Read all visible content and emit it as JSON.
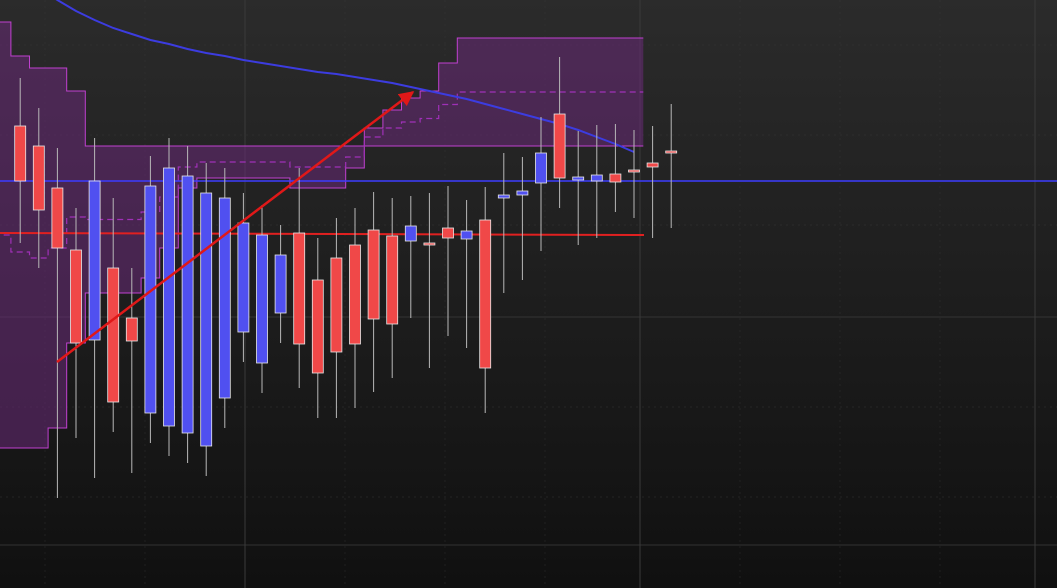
{
  "chart_data": {
    "type": "candlestick",
    "title": "",
    "xlabel": "",
    "ylabel": "",
    "ylim": [
      0,
      588
    ],
    "grid": true,
    "legend": "none",
    "colors": {
      "background_top": "#2b2b2b",
      "background_bottom": "#101010",
      "grid": "#3a3a3a",
      "bullish": "#5050f0",
      "bearish": "#f04848",
      "band_fill": "#6a2a78",
      "band_edge": "#c040d0",
      "midline": "#a030b8",
      "long_ma": "#3c3ce0",
      "horizontal_blue": "#3c3cff",
      "horizontal_red": "#e02020",
      "trend_arrow": "#e01818"
    },
    "candles": [
      {
        "o": 462,
        "h": 480,
        "l": 375,
        "c": 407
      },
      {
        "o": 442,
        "h": 450,
        "l": 350,
        "c": 378
      },
      {
        "o": 400,
        "h": 410,
        "l": 120,
        "c": 340
      },
      {
        "o": 338,
        "h": 350,
        "l": 180,
        "c": 245
      },
      {
        "o": 248,
        "h": 420,
        "l": 140,
        "c": 407
      },
      {
        "o": 320,
        "h": 360,
        "l": 250,
        "c": 186
      },
      {
        "o": 270,
        "h": 290,
        "l": 145,
        "c": 247
      },
      {
        "o": 175,
        "h": 181,
        "l": 360,
        "c": 402
      },
      {
        "o": 162,
        "h": 150,
        "l": 450,
        "c": 420
      },
      {
        "o": 155,
        "h": 170,
        "l": 455,
        "c": 412
      },
      {
        "o": 142,
        "h": 160,
        "l": 430,
        "c": 395
      },
      {
        "o": 190,
        "h": 210,
        "l": 412,
        "c": 390
      },
      {
        "o": 256,
        "h": 276,
        "l": 385,
        "c": 365
      },
      {
        "o": 225,
        "h": 244,
        "l": 363,
        "c": 353
      },
      {
        "o": 275,
        "h": 290,
        "l": 340,
        "c": 333
      },
      {
        "o": 355,
        "h": 390,
        "l": 230,
        "c": 244
      },
      {
        "o": 308,
        "h": 320,
        "l": 200,
        "c": 215
      },
      {
        "o": 330,
        "h": 340,
        "l": 200,
        "c": 236
      },
      {
        "o": 343,
        "h": 350,
        "l": 210,
        "c": 244
      },
      {
        "o": 358,
        "h": 366,
        "l": 226,
        "c": 269
      },
      {
        "o": 352,
        "h": 360,
        "l": 240,
        "c": 264
      },
      {
        "o": 347,
        "h": 362,
        "l": 300,
        "c": 362
      },
      {
        "o": 345,
        "h": 365,
        "l": 250,
        "c": 345
      },
      {
        "o": 360,
        "h": 372,
        "l": 282,
        "c": 350
      },
      {
        "o": 349,
        "h": 358,
        "l": 270,
        "c": 357
      },
      {
        "o": 368,
        "h": 371,
        "l": 205,
        "c": 220
      },
      {
        "o": 390,
        "h": 405,
        "l": 325,
        "c": 393
      },
      {
        "o": 393,
        "h": 401,
        "l": 338,
        "c": 397
      },
      {
        "o": 405,
        "h": 441,
        "l": 367,
        "c": 435
      },
      {
        "o": 474,
        "h": 501,
        "l": 427,
        "c": 410
      },
      {
        "o": 408,
        "h": 427,
        "l": 373,
        "c": 411
      },
      {
        "o": 407,
        "h": 433,
        "l": 380,
        "c": 413
      },
      {
        "o": 414,
        "h": 434,
        "l": 415,
        "c": 406
      },
      {
        "o": 418,
        "h": 428,
        "l": 400,
        "c": 416
      },
      {
        "o": 425,
        "h": 432,
        "l": 380,
        "c": 421
      },
      {
        "o": 437,
        "h": 454,
        "l": 390,
        "c": 437
      }
    ],
    "band_upper": [
      566,
      566,
      532,
      520,
      520,
      497,
      442,
      442,
      442,
      442,
      442,
      442,
      442,
      442,
      442,
      442,
      442,
      442,
      442,
      442,
      442,
      442,
      442,
      442,
      442,
      442,
      442,
      442,
      442,
      442,
      442,
      442,
      442,
      442,
      442,
      442
    ],
    "band_lower": [
      140,
      140,
      140,
      140,
      160,
      245,
      295,
      295,
      295,
      310,
      340,
      400,
      410,
      410,
      410,
      410,
      410,
      400,
      400,
      400,
      420,
      460,
      478,
      490,
      497,
      525,
      550,
      550,
      550,
      550,
      550,
      550,
      550,
      550,
      550,
      550
    ],
    "midline": [
      350,
      352,
      378,
      390,
      415,
      444,
      488,
      500,
      500,
      520,
      536,
      545,
      548,
      552,
      562,
      570,
      575,
      578,
      580,
      590,
      600,
      610,
      615,
      616,
      618,
      618,
      618,
      618,
      618,
      618,
      618,
      618,
      618,
      618,
      618,
      618
    ],
    "long_ma": [
      640,
      628,
      612,
      600,
      588,
      577,
      568,
      560,
      554,
      548,
      544,
      539,
      535,
      532,
      528,
      525,
      522,
      519,
      516,
      514,
      511,
      508,
      505,
      501,
      497,
      493,
      489,
      484,
      479,
      474,
      469,
      464,
      458,
      451,
      444,
      436
    ],
    "horizontal_blue": 407,
    "horizontal_red": 355
  }
}
